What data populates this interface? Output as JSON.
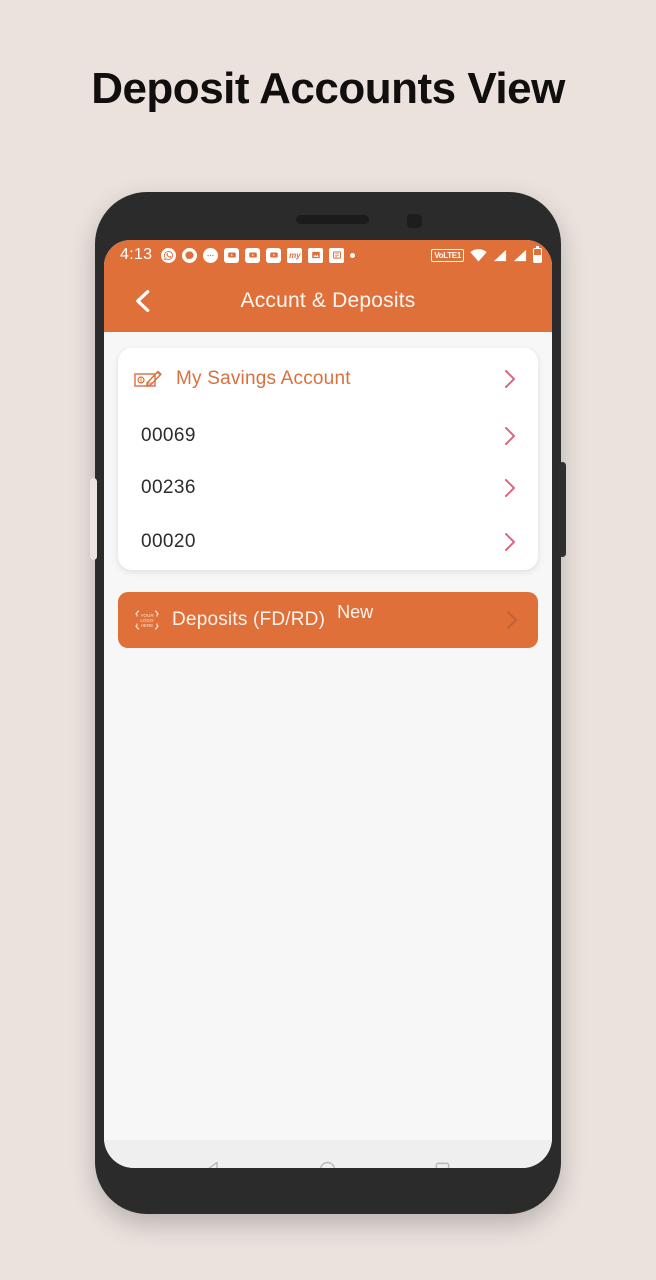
{
  "page": {
    "title": "Deposit Accounts View",
    "background_color": "#ebe2dd",
    "accent_color": "#e0703a",
    "chevron_color": "#d9677f"
  },
  "status_bar": {
    "time": "4:13",
    "notification_icons": [
      {
        "name": "whatsapp-icon",
        "glyph": "✆"
      },
      {
        "name": "messenger-icon",
        "glyph": "●"
      },
      {
        "name": "chat-icon",
        "glyph": "…"
      },
      {
        "name": "video-app-icon-1",
        "glyph": "▶"
      },
      {
        "name": "video-app-icon-2",
        "glyph": "▶"
      },
      {
        "name": "video-app-icon-3",
        "glyph": "▶"
      },
      {
        "name": "my-app-icon",
        "glyph": "my"
      },
      {
        "name": "photo-app-icon",
        "glyph": "▲"
      },
      {
        "name": "shield-app-icon",
        "glyph": "■"
      }
    ],
    "volte_label": "VoLTE",
    "sim_indicator": "1",
    "right_icons": [
      "wifi-icon",
      "signal-icon-1",
      "signal-icon-2",
      "battery-icon"
    ]
  },
  "app_bar": {
    "title": "Accunt & Deposits",
    "back_icon": "back-chevron-icon"
  },
  "savings_card": {
    "header_label": "My Savings Account",
    "header_icon": "cheque-pen-icon",
    "accounts": [
      {
        "number": "00069"
      },
      {
        "number": "00236"
      },
      {
        "number": "00020"
      }
    ]
  },
  "deposits_banner": {
    "label": "Deposits (FD/RD)",
    "badge": "New",
    "icon_text_lines": [
      "YOUR",
      "LOGO",
      "HERE"
    ],
    "icon": "logo-placeholder-icon"
  },
  "nav_bar": {
    "back": "nav-back-icon",
    "home": "nav-home-icon",
    "recents": "nav-recents-icon"
  }
}
